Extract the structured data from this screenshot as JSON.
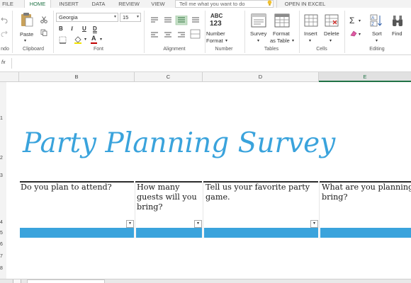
{
  "tabs": [
    "FILE",
    "HOME",
    "INSERT",
    "DATA",
    "REVIEW",
    "VIEW"
  ],
  "tell_me_placeholder": "Tell me what you want to do",
  "open_in_excel": "OPEN IN EXCEL",
  "ribbon": {
    "undo_label": "ndo",
    "clipboard": {
      "paste": "Paste",
      "label": "Clipboard"
    },
    "font": {
      "family": "Georgia",
      "size": "15",
      "bold": "B",
      "italic": "I",
      "underline": "U",
      "double_underline": "D",
      "font_color_letter": "A",
      "label": "Font"
    },
    "alignment": {
      "label": "Alignment"
    },
    "number": {
      "abc": "ABC",
      "digits": "123",
      "format_line1": "Number",
      "format_line2": "Format",
      "label": "Number"
    },
    "tables": {
      "survey": "Survey",
      "format_line1": "Format",
      "format_line2": "as Table",
      "label": "Tables"
    },
    "cells": {
      "insert": "Insert",
      "delete": "Delete",
      "label": "Cells"
    },
    "editing": {
      "sort": "Sort",
      "find": "Find",
      "label": "Editing"
    }
  },
  "formula_bar": {
    "fx": "fx"
  },
  "columns": [
    "B",
    "C",
    "D",
    "E"
  ],
  "rows": [
    "1",
    "2",
    "3",
    "4",
    "5",
    "6",
    "7",
    "8"
  ],
  "sheet": {
    "title": "Party Planning Survey",
    "questions": [
      "Do you plan to attend?",
      "How many guests will you bring?",
      "Tell us your favorite party game.",
      "What are you planning to bring?"
    ]
  },
  "colors": {
    "accent_blue": "#3aa3dc",
    "excel_green": "#217346"
  }
}
